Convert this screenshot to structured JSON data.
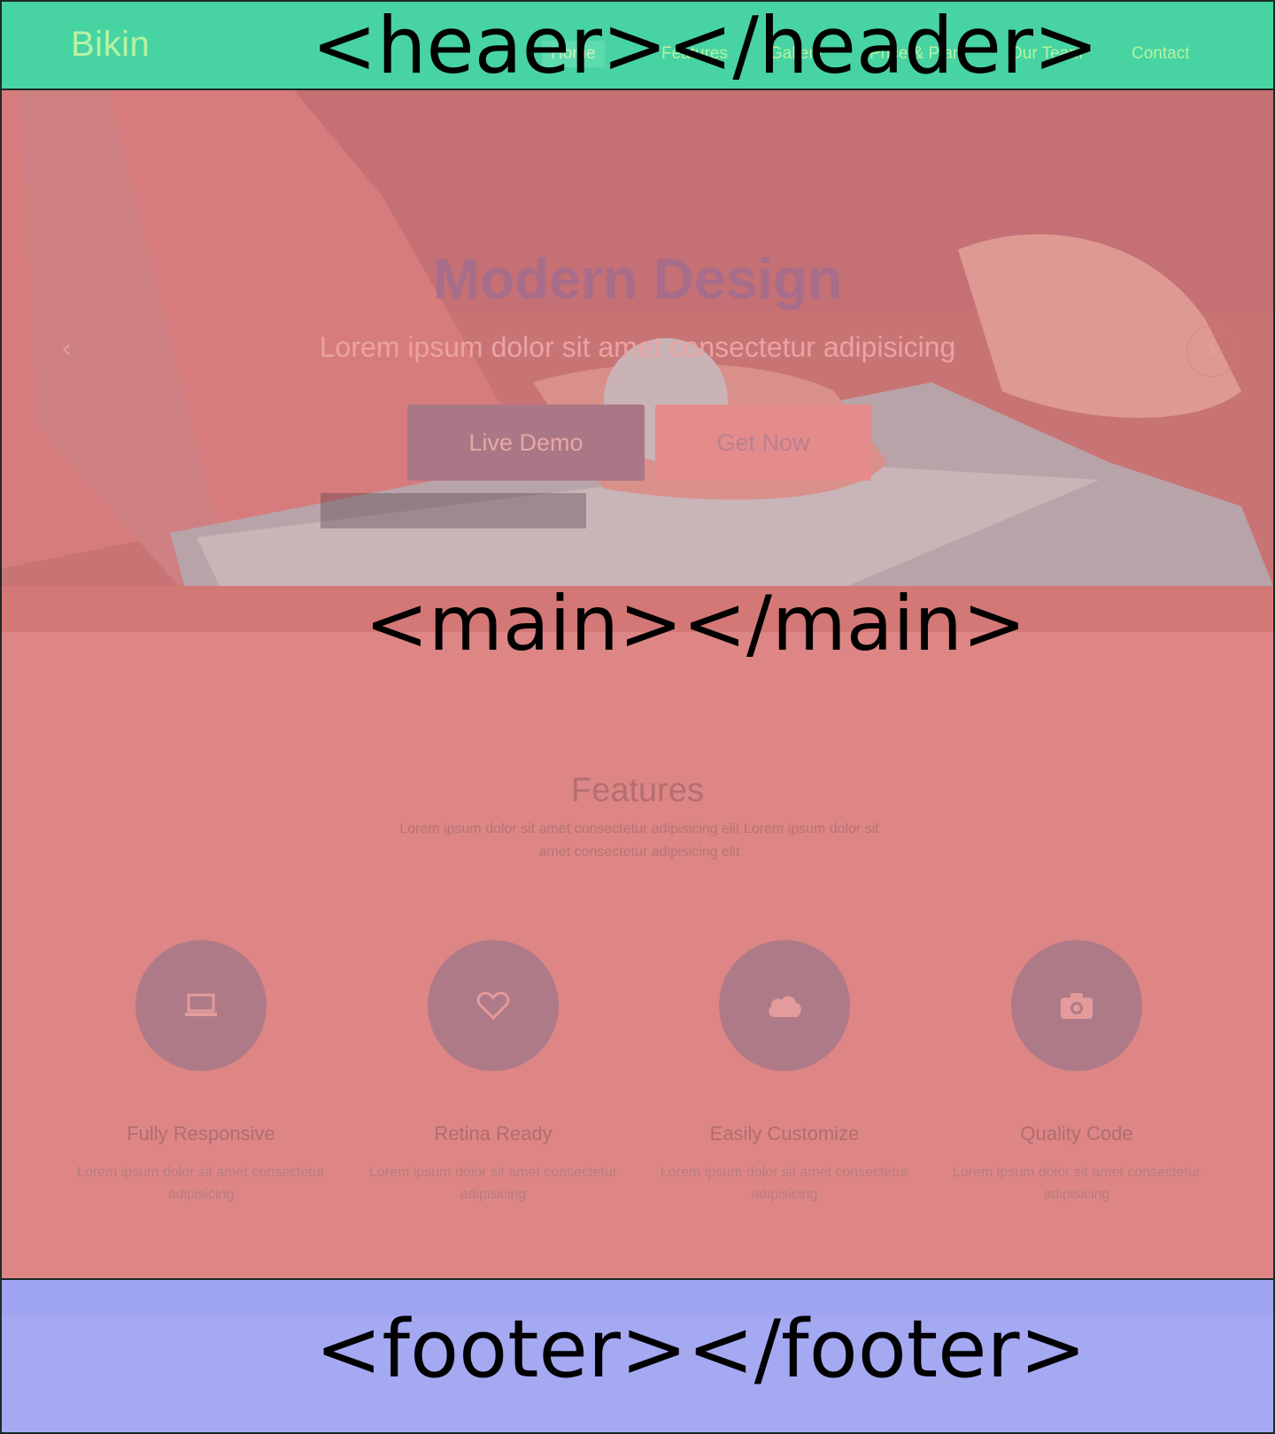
{
  "header": {
    "logo": "Bikin",
    "nav": [
      "Home",
      "Features",
      "Gallery",
      "Price & Plan",
      "Our Team",
      "Contact"
    ],
    "overlay_tag": "<heaer></header>"
  },
  "hero": {
    "title": "Modern Design",
    "subtitle": "Lorem ipsum dolor sit amet consectetur adipisicing",
    "btn_demo": "Live Demo",
    "btn_get": "Get Now",
    "prev_arrow": "‹",
    "next_arrow": "›"
  },
  "main": {
    "overlay_tag": "<main></main>",
    "features_title": "Features",
    "features_desc": "Lorem ipsum dolor sit amet consectetur adipisicing elit Lorem ipsum dolor sit amet consectetur adipisicing elit",
    "features": [
      {
        "icon": "laptop-icon",
        "title": "Fully Responsive",
        "desc": "Lorem ipsum dolor sit amet consectetur adipisicing"
      },
      {
        "icon": "heart-icon",
        "title": "Retina Ready",
        "desc": "Lorem ipsum dolor sit amet consectetur adipisicing"
      },
      {
        "icon": "cloud-icon",
        "title": "Easily Customize",
        "desc": "Lorem ipsum dolor sit amet consectetur adipisicing"
      },
      {
        "icon": "camera-icon",
        "title": "Quality Code",
        "desc": "Lorem ipsum dolor sit amet consectetur adipisicing"
      }
    ]
  },
  "footer": {
    "overlay_tag": "<footer></footer>"
  },
  "colors": {
    "header_overlay": "#47d4a2",
    "main_overlay": "#dd8685",
    "footer_overlay": "#a4a9f2",
    "accent": "#af7a87"
  }
}
